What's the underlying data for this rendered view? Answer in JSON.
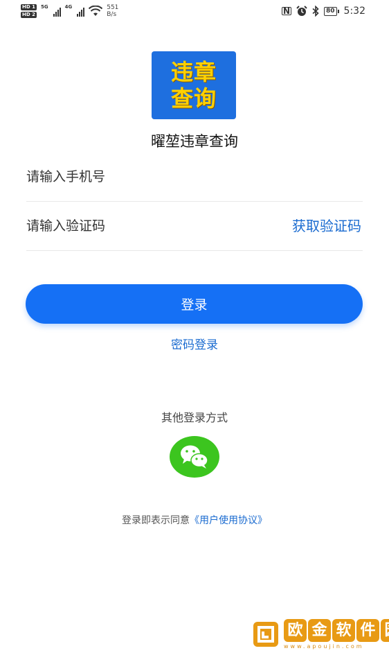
{
  "status_bar": {
    "hd1": "HD 1",
    "hd2": "HD 2",
    "net1": "5G",
    "net2": "4G",
    "speed_value": "551",
    "speed_unit": "B/s",
    "nfc": "N",
    "battery": "80",
    "time": "5:32"
  },
  "app": {
    "logo_line1": "违章",
    "logo_line2": "查询",
    "title": "曜堃违章查询"
  },
  "form": {
    "phone_placeholder": "请输入手机号",
    "phone_value": "",
    "code_placeholder": "请输入验证码",
    "code_value": "",
    "get_code": "获取验证码",
    "login": "登录",
    "password_login": "密码登录"
  },
  "other": {
    "label": "其他登录方式",
    "wechat_icon": "wechat-icon"
  },
  "agreement": {
    "prefix": "登录即表示同意",
    "link": "《用户使用协议》"
  },
  "watermark": {
    "chars": [
      "欧",
      "金",
      "软",
      "件",
      "园"
    ],
    "url": "www.apoujin.com"
  },
  "colors": {
    "accent": "#1570f5",
    "link": "#1a6bd0",
    "wechat": "#3cc51f",
    "logo_bg": "#1e6fdf",
    "logo_text": "#ffd000"
  }
}
